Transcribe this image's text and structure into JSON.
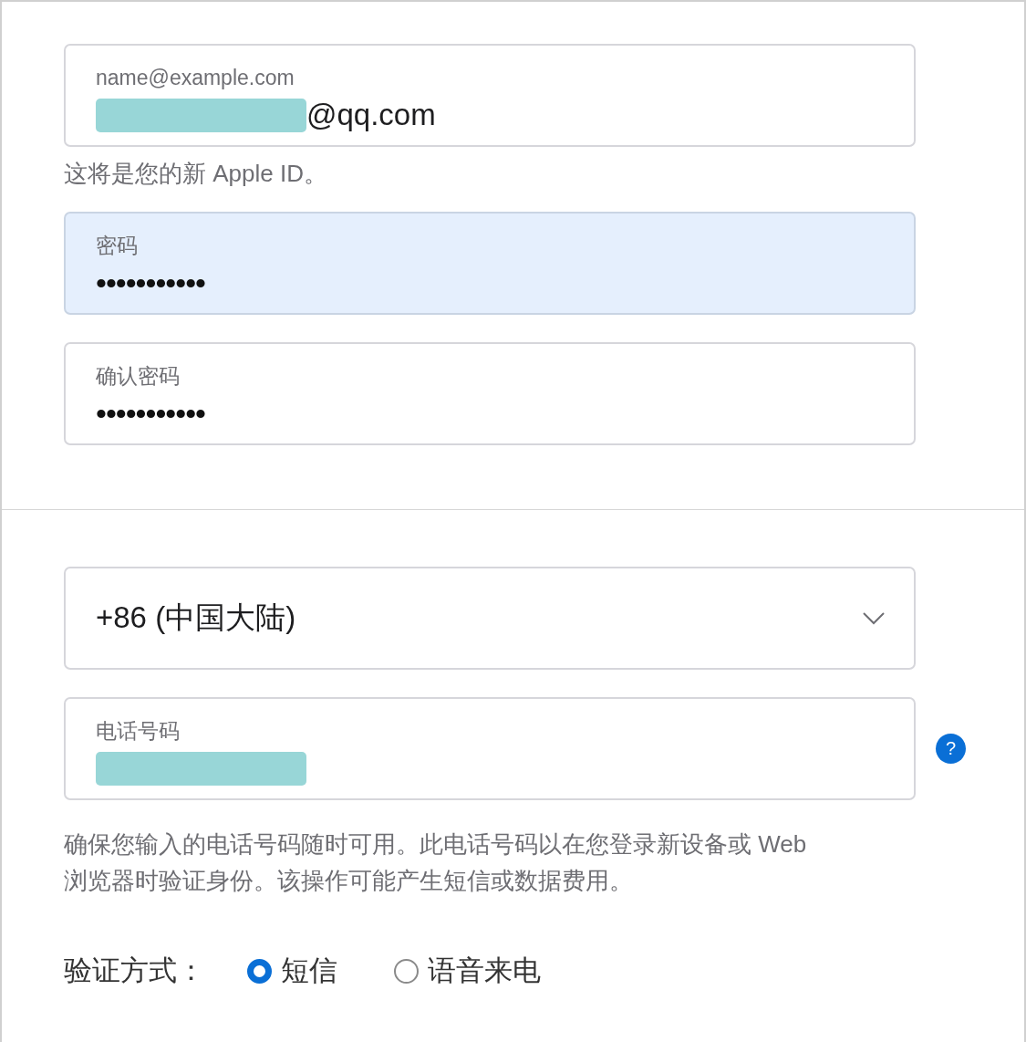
{
  "email": {
    "label": "name@example.com",
    "redacted": true,
    "value": "@qq.com",
    "focused": false
  },
  "email_note": "这将是您的新 Apple ID。",
  "password": {
    "label": "密码",
    "value": "•••••••••••",
    "focused": true
  },
  "confirm_password": {
    "label": "确认密码",
    "value": "•••••••••••",
    "focused": false
  },
  "country": {
    "value": "+86 (中国大陆)"
  },
  "phone": {
    "label": "电话号码",
    "redacted": true,
    "focused": false,
    "help": "?"
  },
  "phone_note": "确保您输入的电话号码随时可用。此电话号码以在您登录新设备或 Web 浏览器时验证身份。该操作可能产生短信或数据费用。",
  "verification": {
    "label": "验证方式：",
    "options": [
      {
        "label": "短信",
        "selected": true
      },
      {
        "label": "语音来电",
        "selected": false
      }
    ]
  }
}
